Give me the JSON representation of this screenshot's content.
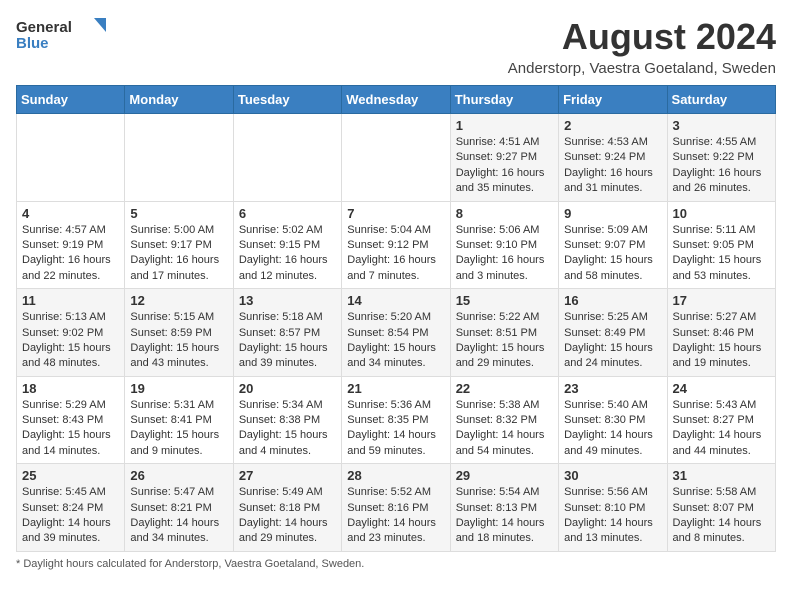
{
  "header": {
    "logo_general": "General",
    "logo_blue": "Blue",
    "month_title": "August 2024",
    "location": "Anderstorp, Vaestra Goetaland, Sweden"
  },
  "days_of_week": [
    "Sunday",
    "Monday",
    "Tuesday",
    "Wednesday",
    "Thursday",
    "Friday",
    "Saturday"
  ],
  "weeks": [
    [
      {
        "day": "",
        "info": ""
      },
      {
        "day": "",
        "info": ""
      },
      {
        "day": "",
        "info": ""
      },
      {
        "day": "",
        "info": ""
      },
      {
        "day": "1",
        "info": "Sunrise: 4:51 AM\nSunset: 9:27 PM\nDaylight: 16 hours and 35 minutes."
      },
      {
        "day": "2",
        "info": "Sunrise: 4:53 AM\nSunset: 9:24 PM\nDaylight: 16 hours and 31 minutes."
      },
      {
        "day": "3",
        "info": "Sunrise: 4:55 AM\nSunset: 9:22 PM\nDaylight: 16 hours and 26 minutes."
      }
    ],
    [
      {
        "day": "4",
        "info": "Sunrise: 4:57 AM\nSunset: 9:19 PM\nDaylight: 16 hours and 22 minutes."
      },
      {
        "day": "5",
        "info": "Sunrise: 5:00 AM\nSunset: 9:17 PM\nDaylight: 16 hours and 17 minutes."
      },
      {
        "day": "6",
        "info": "Sunrise: 5:02 AM\nSunset: 9:15 PM\nDaylight: 16 hours and 12 minutes."
      },
      {
        "day": "7",
        "info": "Sunrise: 5:04 AM\nSunset: 9:12 PM\nDaylight: 16 hours and 7 minutes."
      },
      {
        "day": "8",
        "info": "Sunrise: 5:06 AM\nSunset: 9:10 PM\nDaylight: 16 hours and 3 minutes."
      },
      {
        "day": "9",
        "info": "Sunrise: 5:09 AM\nSunset: 9:07 PM\nDaylight: 15 hours and 58 minutes."
      },
      {
        "day": "10",
        "info": "Sunrise: 5:11 AM\nSunset: 9:05 PM\nDaylight: 15 hours and 53 minutes."
      }
    ],
    [
      {
        "day": "11",
        "info": "Sunrise: 5:13 AM\nSunset: 9:02 PM\nDaylight: 15 hours and 48 minutes."
      },
      {
        "day": "12",
        "info": "Sunrise: 5:15 AM\nSunset: 8:59 PM\nDaylight: 15 hours and 43 minutes."
      },
      {
        "day": "13",
        "info": "Sunrise: 5:18 AM\nSunset: 8:57 PM\nDaylight: 15 hours and 39 minutes."
      },
      {
        "day": "14",
        "info": "Sunrise: 5:20 AM\nSunset: 8:54 PM\nDaylight: 15 hours and 34 minutes."
      },
      {
        "day": "15",
        "info": "Sunrise: 5:22 AM\nSunset: 8:51 PM\nDaylight: 15 hours and 29 minutes."
      },
      {
        "day": "16",
        "info": "Sunrise: 5:25 AM\nSunset: 8:49 PM\nDaylight: 15 hours and 24 minutes."
      },
      {
        "day": "17",
        "info": "Sunrise: 5:27 AM\nSunset: 8:46 PM\nDaylight: 15 hours and 19 minutes."
      }
    ],
    [
      {
        "day": "18",
        "info": "Sunrise: 5:29 AM\nSunset: 8:43 PM\nDaylight: 15 hours and 14 minutes."
      },
      {
        "day": "19",
        "info": "Sunrise: 5:31 AM\nSunset: 8:41 PM\nDaylight: 15 hours and 9 minutes."
      },
      {
        "day": "20",
        "info": "Sunrise: 5:34 AM\nSunset: 8:38 PM\nDaylight: 15 hours and 4 minutes."
      },
      {
        "day": "21",
        "info": "Sunrise: 5:36 AM\nSunset: 8:35 PM\nDaylight: 14 hours and 59 minutes."
      },
      {
        "day": "22",
        "info": "Sunrise: 5:38 AM\nSunset: 8:32 PM\nDaylight: 14 hours and 54 minutes."
      },
      {
        "day": "23",
        "info": "Sunrise: 5:40 AM\nSunset: 8:30 PM\nDaylight: 14 hours and 49 minutes."
      },
      {
        "day": "24",
        "info": "Sunrise: 5:43 AM\nSunset: 8:27 PM\nDaylight: 14 hours and 44 minutes."
      }
    ],
    [
      {
        "day": "25",
        "info": "Sunrise: 5:45 AM\nSunset: 8:24 PM\nDaylight: 14 hours and 39 minutes."
      },
      {
        "day": "26",
        "info": "Sunrise: 5:47 AM\nSunset: 8:21 PM\nDaylight: 14 hours and 34 minutes."
      },
      {
        "day": "27",
        "info": "Sunrise: 5:49 AM\nSunset: 8:18 PM\nDaylight: 14 hours and 29 minutes."
      },
      {
        "day": "28",
        "info": "Sunrise: 5:52 AM\nSunset: 8:16 PM\nDaylight: 14 hours and 23 minutes."
      },
      {
        "day": "29",
        "info": "Sunrise: 5:54 AM\nSunset: 8:13 PM\nDaylight: 14 hours and 18 minutes."
      },
      {
        "day": "30",
        "info": "Sunrise: 5:56 AM\nSunset: 8:10 PM\nDaylight: 14 hours and 13 minutes."
      },
      {
        "day": "31",
        "info": "Sunrise: 5:58 AM\nSunset: 8:07 PM\nDaylight: 14 hours and 8 minutes."
      }
    ]
  ],
  "footer": {
    "note": "Daylight hours"
  }
}
